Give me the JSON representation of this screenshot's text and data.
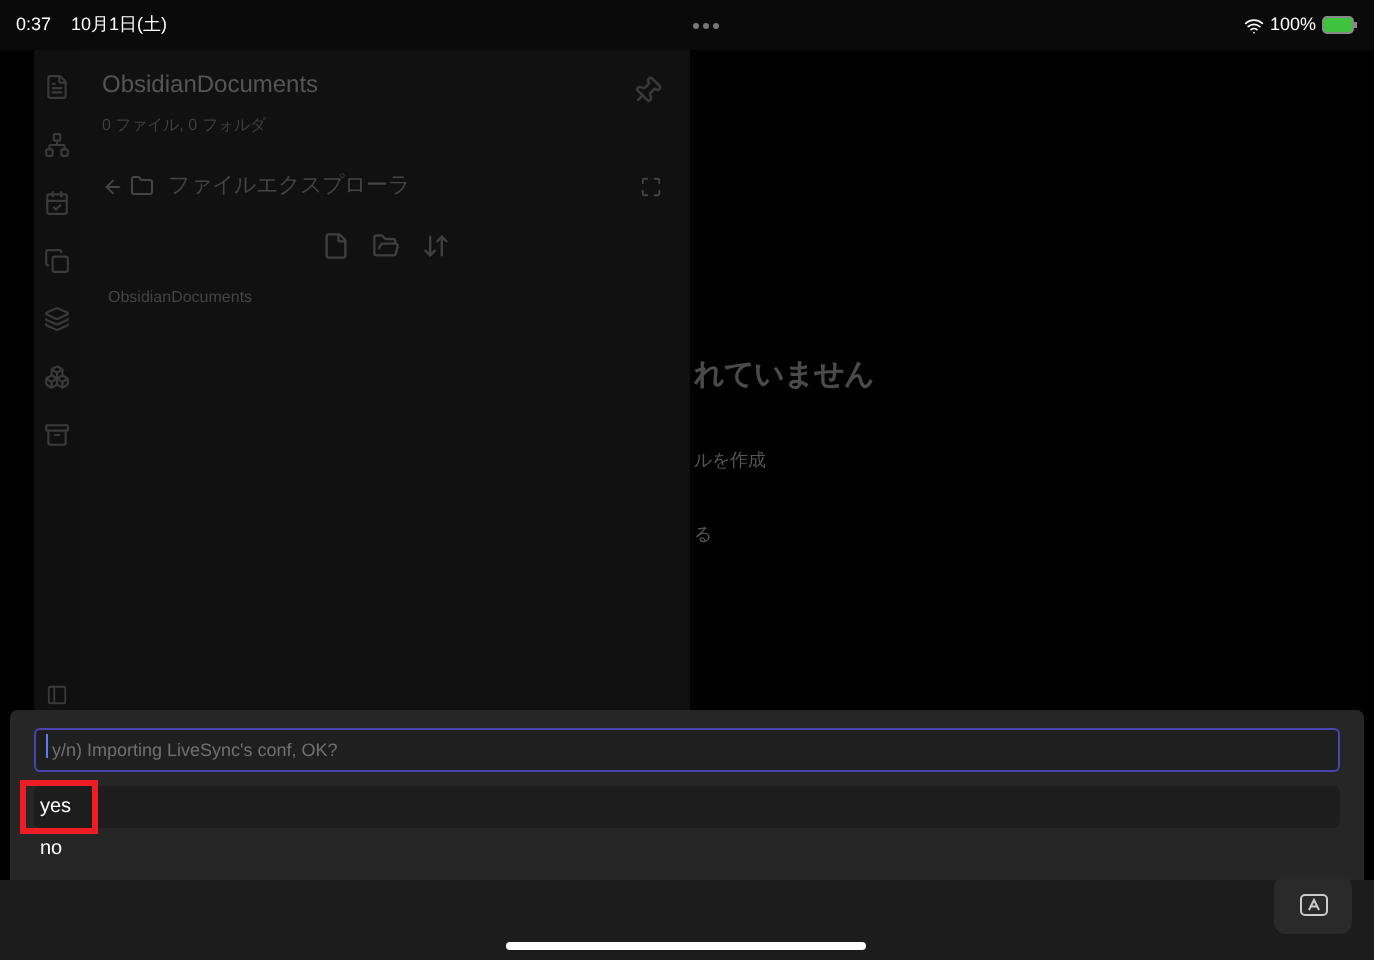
{
  "status_bar": {
    "time": "0:37",
    "date": "10月1日(土)",
    "battery": "100%"
  },
  "sidebar": {
    "vault_name": "ObsidianDocuments",
    "counts": "0 ファイル, 0 フォルダ",
    "panel_title": "ファイルエクスプローラ",
    "file_tree": [
      {
        "label": "ObsidianDocuments"
      }
    ]
  },
  "main": {
    "heading": "れていません",
    "actions": [
      "ルを作成",
      "る"
    ]
  },
  "prompt": {
    "placeholder": "y/n) Importing LiveSync's conf, OK?",
    "options": [
      {
        "label": "yes",
        "selected": true,
        "annotated": true
      },
      {
        "label": "no",
        "selected": false,
        "annotated": false
      }
    ]
  }
}
